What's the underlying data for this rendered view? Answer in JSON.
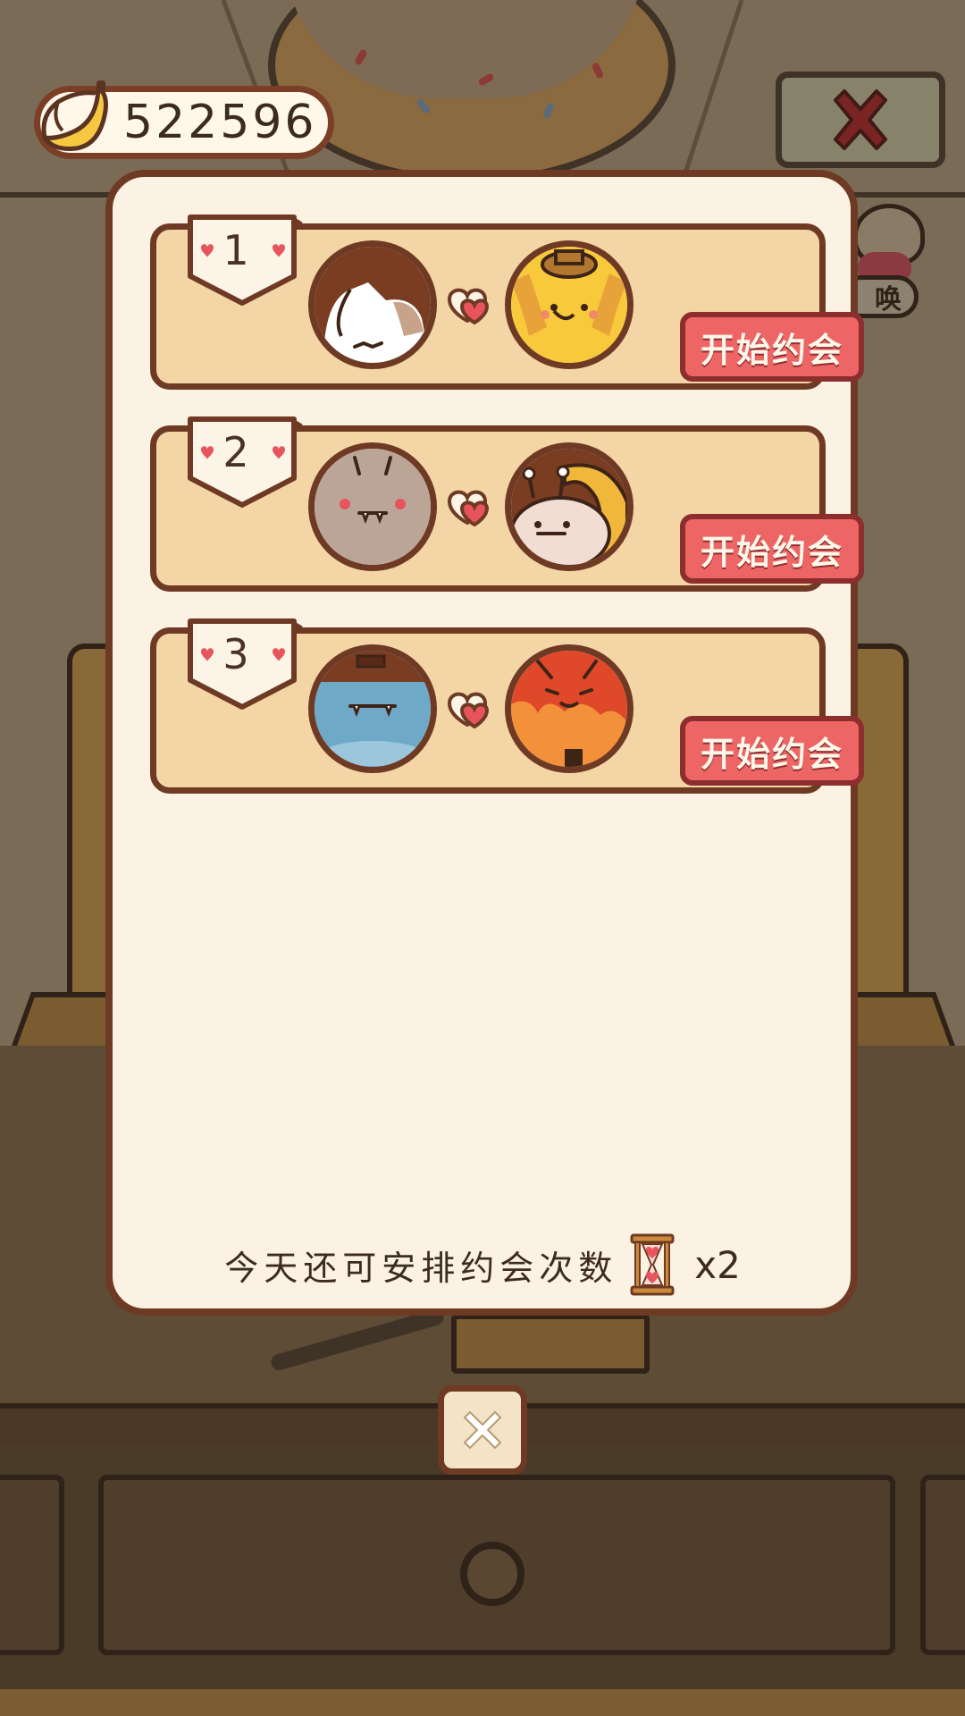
{
  "hud": {
    "banana_count": "522596",
    "currency_icon": "banana-icon"
  },
  "background": {
    "summon_chip_text": "唤"
  },
  "dates": [
    {
      "rank": "1",
      "button_label": "开始约会",
      "left_avatar": "white-brown-patch-creature",
      "right_avatar": "yellow-dog-with-hat"
    },
    {
      "rank": "2",
      "button_label": "开始约会",
      "left_avatar": "grey-horned-blob",
      "right_avatar": "snail-creature"
    },
    {
      "rank": "3",
      "button_label": "开始约会",
      "left_avatar": "blue-blob-with-cap",
      "right_avatar": "orange-fluffy-creature"
    }
  ],
  "footer": {
    "label": "今天还可安排约会次数",
    "count": "x2",
    "icon": "hourglass-heart-icon"
  },
  "colors": {
    "accent_button": "#ee6565",
    "card_fill": "#f3d5a6",
    "panel_fill": "#fbf2e3",
    "outline": "#6e3a24"
  }
}
